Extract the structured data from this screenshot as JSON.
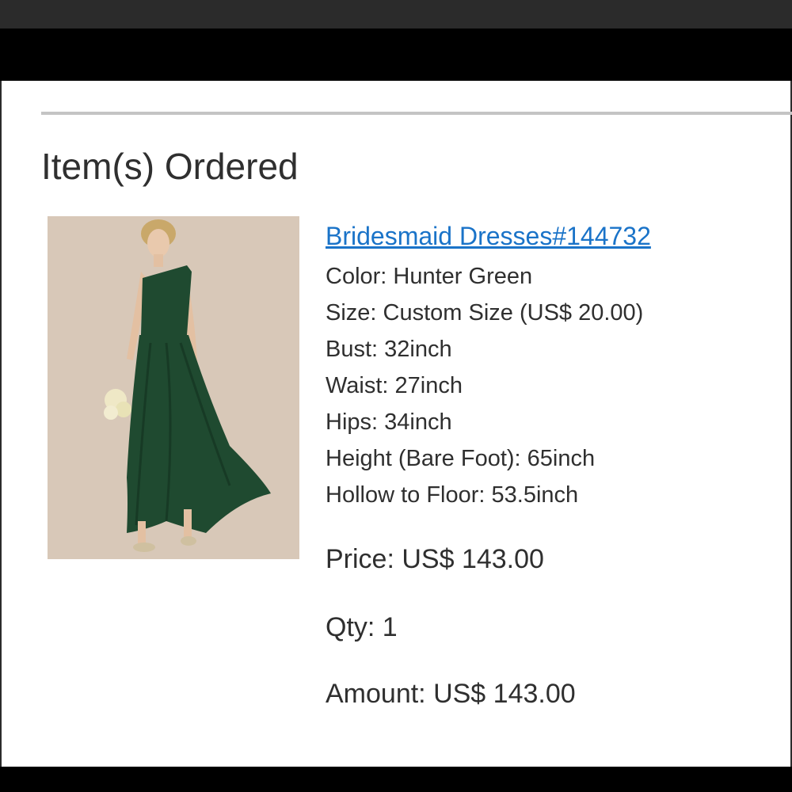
{
  "section": {
    "title": "Item(s) Ordered"
  },
  "product": {
    "link_text": "Bridesmaid Dresses#144732",
    "image_icon": "product-photo-bridesmaid-dress",
    "attributes": [
      "Color: Hunter Green",
      "Size: Custom Size (US$ 20.00)",
      "Bust: 32inch",
      "Waist: 27inch",
      "Hips: 34inch",
      "Height (Bare Foot): 65inch",
      "Hollow to Floor: 53.5inch"
    ]
  },
  "summary": {
    "price": "Price: US$ 143.00",
    "qty": "Qty: 1",
    "amount": "Amount: US$ 143.00"
  },
  "colors": {
    "link": "#1a73c8",
    "text": "#2f2f2f",
    "dress": "#1f4a30",
    "image_background": "#d8c8b8"
  }
}
